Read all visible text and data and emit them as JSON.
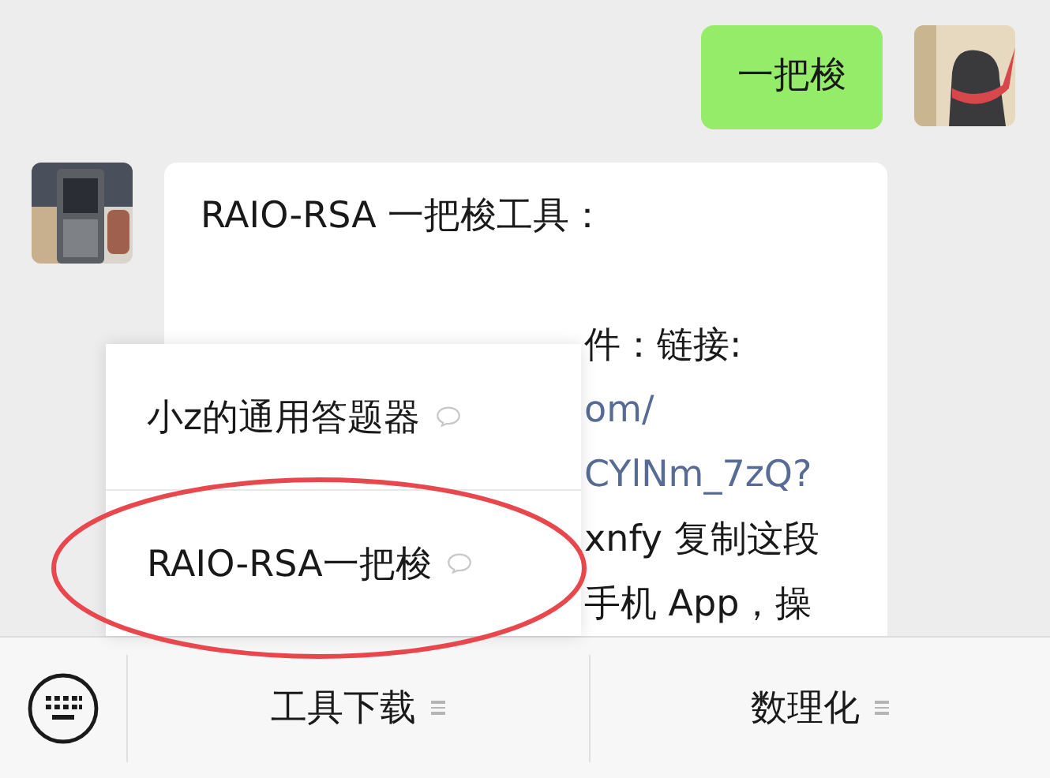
{
  "messages": [
    {
      "outgoing": true,
      "kind": "text",
      "paragraphs": [
        [
          {
            "kind": "text",
            "text": "一把梭"
          }
        ]
      ]
    },
    {
      "outgoing": false,
      "kind": "text",
      "paragraphs": [
        [
          {
            "kind": "text",
            "text": "RAIO-RSA 一把梭工具："
          }
        ],
        [
          {
            "kind": "partial",
            "text": "件：链接:"
          },
          {
            "kind": "partial-link",
            "text": "om/"
          },
          {
            "kind": "partial-link",
            "text": "CYlNm_7zQ?"
          },
          {
            "kind": "partial",
            "text": "xnfy 复制这段"
          },
          {
            "kind": "partial",
            "text": "手机 App，操"
          }
        ]
      ]
    }
  ],
  "popup_menu": {
    "items": [
      {
        "label": "小z的通用答题器",
        "circled": false
      },
      {
        "label": "RAIO-RSA一把梭",
        "circled": true
      }
    ]
  },
  "bottom_bar": {
    "menus": [
      {
        "label": "工具下载"
      },
      {
        "label": "数理化"
      }
    ]
  }
}
